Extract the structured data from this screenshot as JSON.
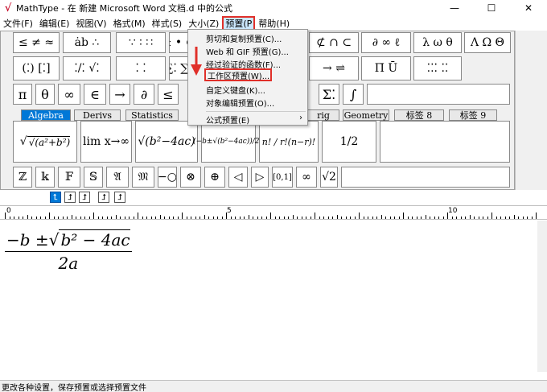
{
  "window": {
    "title": "MathType - 在 新建 Microsoft Word 文档.d 中的公式",
    "minimize_glyph": "—",
    "maximize_glyph": "☐",
    "close_glyph": "✕"
  },
  "menubar": {
    "items": [
      "文件(F)",
      "编辑(E)",
      "视图(V)",
      "格式(M)",
      "样式(S)",
      "大小(Z)",
      "预置(P",
      "帮助(H)"
    ]
  },
  "toolbar": {
    "row1": [
      "≤ ≠ ≈",
      "ȧb ∴",
      "∵ ∶ ∷",
      "± • ⊗",
      "⊄ ∩ ⊂",
      "∂ ∞ ℓ",
      "λ ω θ",
      "Λ Ω Θ"
    ],
    "row2": [
      "(⁚) [⁚]",
      "⁚/⁚ √⁚",
      "⁚ ⁚",
      "∑⁚ ∑⁚",
      "→ ⇌",
      "Π̄ Ū",
      "⁚⁚⁚ ⁚⁚"
    ],
    "row3": [
      "π",
      "θ",
      "∞",
      "∈",
      "→",
      "∂",
      "≤",
      "Σ⁚",
      "∫"
    ],
    "row5": [
      "ℤ",
      "𝕜",
      "𝔽",
      "𝕊",
      "𝔄",
      "𝔐",
      "−○",
      "⊗",
      "⊕",
      "◁",
      "▷",
      "[0,1]",
      "∞",
      "√2"
    ]
  },
  "tabs": [
    "Algebra",
    "Derivs",
    "Statistics",
    "rig",
    "Geometry",
    "标签 8",
    "标签 9"
  ],
  "templates": [
    "√(a²+b²)",
    "lim x→∞",
    "√(b²−4ac)",
    "(−b±√(b²−4ac))/2a",
    "n! / r!(n−r)!",
    "1/2"
  ],
  "small_buttons": [
    "⮤",
    "⮥",
    "⮥",
    "⮥",
    "⮥"
  ],
  "ruler": {
    "labels": [
      "0",
      "5",
      "10"
    ]
  },
  "formula": {
    "minus_b": "−b ±",
    "sqrt_content": "b² − 4ac",
    "denominator": "2a"
  },
  "dropdown": {
    "items": [
      "剪切和复制预置(C)...",
      "Web 和 GIF 预置(G)...",
      "经过验证的函数(F)...",
      "工作区预置(W)...",
      "自定义键盘(K)...",
      "对象编辑预置(O)...",
      "公式预置(E)"
    ],
    "submenu_arrow": "›"
  },
  "status": "更改各种设置，保存预置或选择预置文件",
  "colors": {
    "highlight_red": "#e0302a",
    "active_tab": "#0078d7",
    "menu_hover": "#cce8ff"
  }
}
